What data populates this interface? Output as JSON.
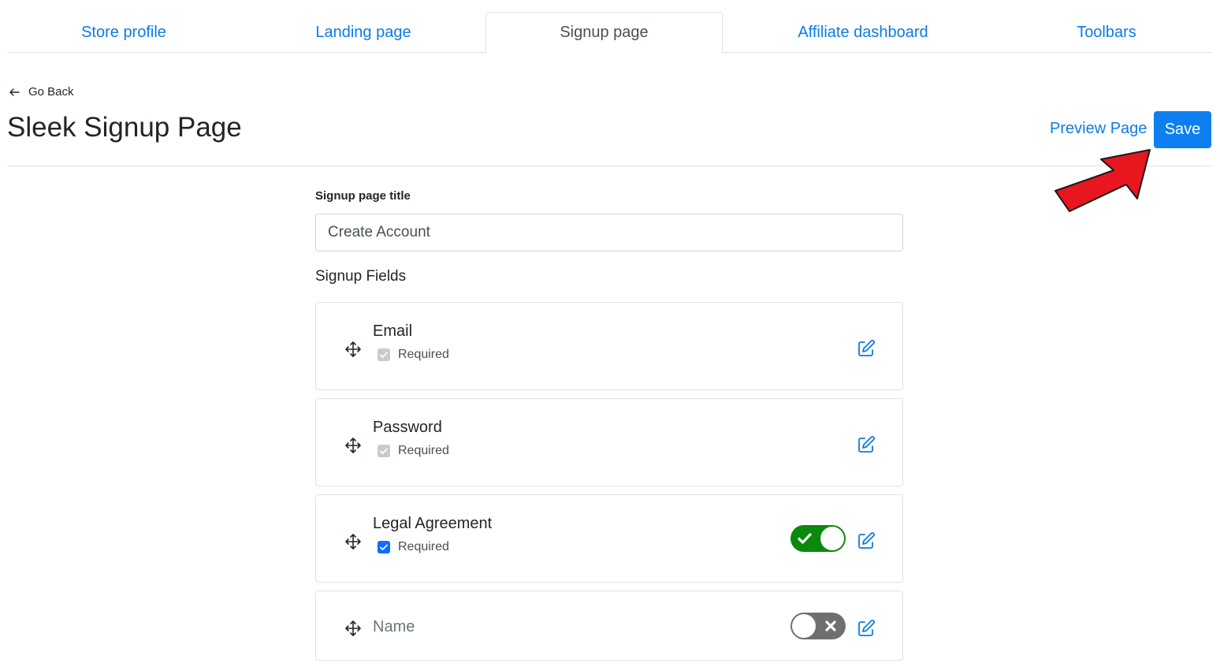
{
  "tabs": [
    {
      "label": "Store profile",
      "active": false
    },
    {
      "label": "Landing page",
      "active": false
    },
    {
      "label": "Signup page",
      "active": true
    },
    {
      "label": "Affiliate dashboard",
      "active": false
    },
    {
      "label": "Toolbars",
      "active": false
    }
  ],
  "header": {
    "go_back": "Go Back",
    "title": "Sleek Signup Page",
    "preview_label": "Preview Page",
    "save_label": "Save"
  },
  "form": {
    "title_label": "Signup page title",
    "title_value": "Create Account",
    "fields_label": "Signup Fields"
  },
  "fields": [
    {
      "name": "Email",
      "required_label": "Required",
      "required": true,
      "required_locked": true,
      "toggle": null
    },
    {
      "name": "Password",
      "required_label": "Required",
      "required": true,
      "required_locked": true,
      "toggle": null
    },
    {
      "name": "Legal Agreement",
      "required_label": "Required",
      "required": true,
      "required_locked": false,
      "toggle": "on"
    },
    {
      "name": "Name",
      "required_label": "",
      "required": false,
      "required_locked": false,
      "toggle": "off"
    }
  ],
  "colors": {
    "link": "#0d7be8",
    "primary_button": "#0d7ff0",
    "toggle_on": "#0a8a0a",
    "toggle_off": "#6f6f6f",
    "annotation_arrow": "#e8161e"
  }
}
